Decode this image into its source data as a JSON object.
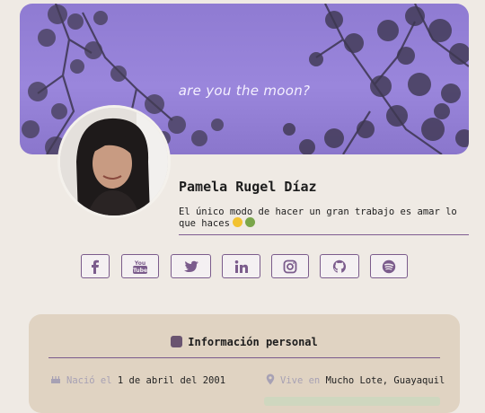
{
  "banner": {
    "text": "are you the moon?"
  },
  "profile": {
    "name": "Pamela Rugel Díaz",
    "quote": "El único modo de hacer un gran trabajo es amar lo que haces"
  },
  "socials": [
    {
      "label": "Facebook",
      "icon": "facebook-icon"
    },
    {
      "label": "YouTube",
      "icon": "youtube-icon"
    },
    {
      "label": "Twitter",
      "icon": "twitter-icon"
    },
    {
      "label": "LinkedIn",
      "icon": "linkedin-icon"
    },
    {
      "label": "Instagram",
      "icon": "instagram-icon"
    },
    {
      "label": "GitHub",
      "icon": "github-icon"
    },
    {
      "label": "Spotify",
      "icon": "spotify-icon"
    }
  ],
  "personal": {
    "title": "Información personal",
    "born_prefix": "Nació el ",
    "born_value": "1 de abril del 2001",
    "lives_prefix": "Vive en ",
    "lives_value": "Mucho Lote, Guayaquil"
  },
  "colors": {
    "accent": "#7b5c8c",
    "banner": "#9a86dc",
    "panel": "#e0d3c2",
    "background": "#efeae4"
  }
}
